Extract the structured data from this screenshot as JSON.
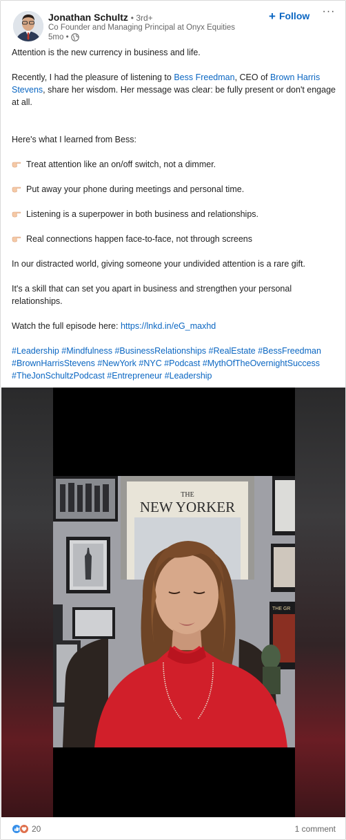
{
  "author": {
    "name": "Jonathan Schultz",
    "degree": "• 3rd+",
    "headline": "Co Founder and Managing Principal at Onyx Equities",
    "age": "5mo •",
    "follow_label": "Follow",
    "more_label": "···"
  },
  "post": {
    "p1": "Attention is the new currency in business and life.",
    "p2_pre": "Recently, I had the pleasure of listening to ",
    "p2_link1": "Bess Freedman",
    "p2_mid": ", CEO of ",
    "p2_link2": "Brown Harris Stevens",
    "p2_post": ", share her wisdom. Her message was clear: be fully present or don't engage at all.",
    "p3": "Here's what I learned from Bess:",
    "bullets": [
      "Treat attention like an on/off switch, not a dimmer.",
      "Put away your phone during meetings and personal time.",
      "Listening is a superpower in both business and relationships.",
      "Real connections happen face-to-face, not through screens"
    ],
    "p4": "In our distracted world, giving someone your undivided attention is a rare gift.",
    "p5": "It's a skill that can set you apart in business and strengthen your personal relationships.",
    "p6_pre": "Watch the full episode here: ",
    "p6_link": "https://lnkd.in/eG_maxhd",
    "hashtags": [
      "#Leadership",
      "#Mindfulness",
      "#BusinessRelationships",
      "#RealEstate",
      "#BessFreedman",
      "#BrownHarrisStevens",
      "#NewYork",
      "#NYC",
      "#Podcast",
      "#MythOfTheOvernightSuccess",
      "#TheJonSchultzPodcast",
      "#Entrepreneur",
      "#Leadership"
    ]
  },
  "video": {
    "magazine_title": "THE NEW YORKER",
    "magazine_the": "THE",
    "magazine_ny": "NEW YORKER",
    "poster_text": "THE GR"
  },
  "footer": {
    "reaction_count": "20",
    "comments": "1 comment"
  },
  "colors": {
    "link": "#0a66c2",
    "like": "#378fe9",
    "love": "#df704d"
  }
}
